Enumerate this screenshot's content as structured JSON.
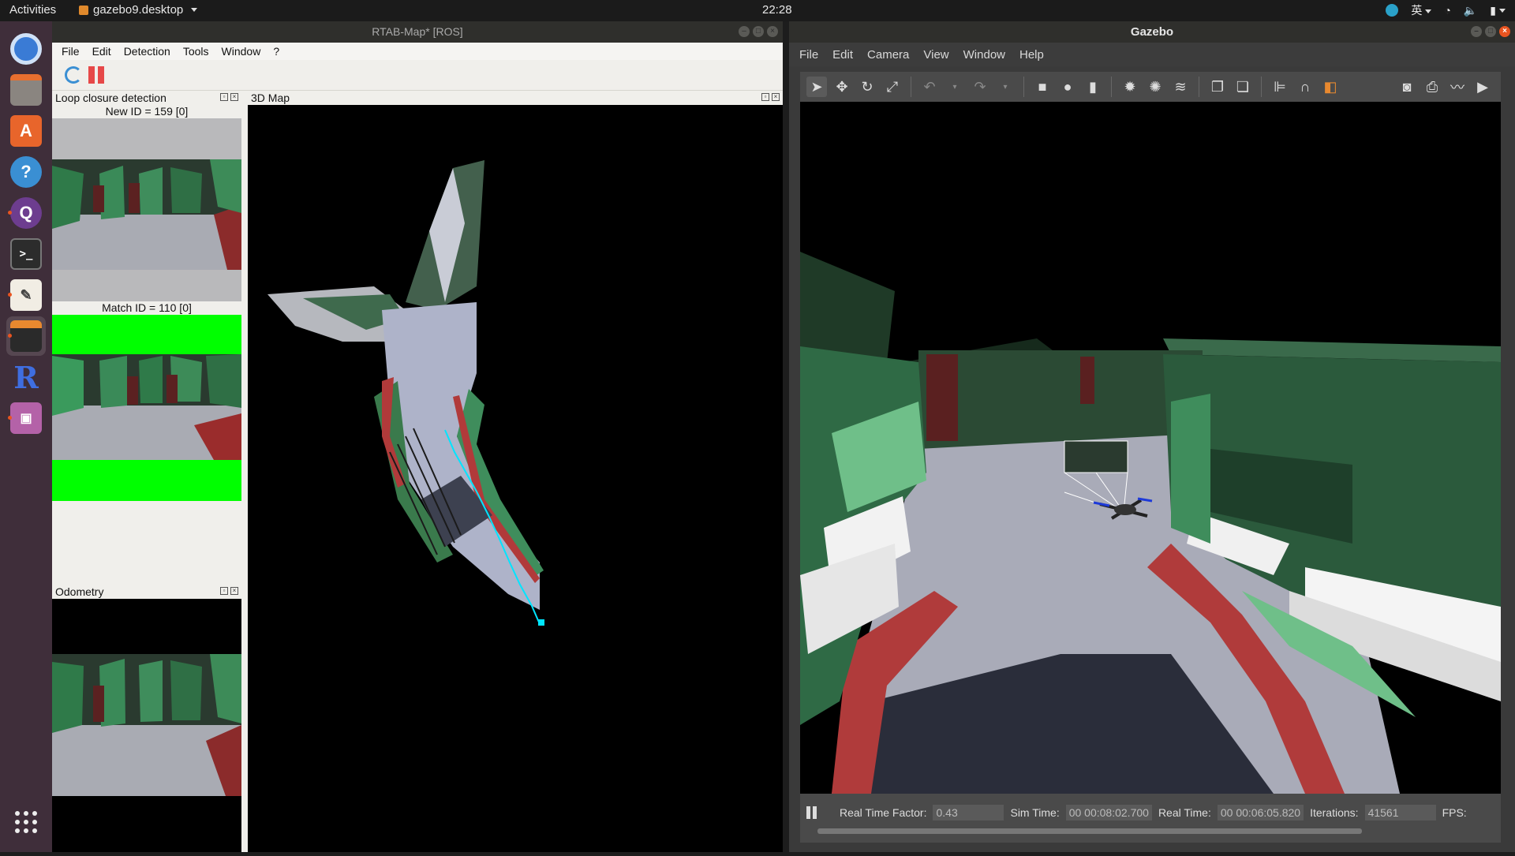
{
  "topbar": {
    "activities": "Activities",
    "app_name": "gazebo9.desktop",
    "clock": "22:28",
    "ime": "英"
  },
  "dock": {
    "items": [
      "chromium",
      "files",
      "software-center",
      "help",
      "qt-creator",
      "terminal",
      "text-editor",
      "rviz",
      "rtabmap",
      "network"
    ]
  },
  "rtab": {
    "title": "RTAB-Map* [ROS]",
    "menu": [
      "File",
      "Edit",
      "Detection",
      "Tools",
      "Window",
      "?"
    ],
    "loop_panel": {
      "title": "Loop closure detection",
      "new_id": "New ID = 159 [0]",
      "match_id": "Match ID = 110 [0]"
    },
    "odometry_panel": {
      "title": "Odometry"
    },
    "map_panel": {
      "title": "3D Map"
    }
  },
  "gazebo": {
    "title": "Gazebo",
    "menu": [
      "File",
      "Edit",
      "Camera",
      "View",
      "Window",
      "Help"
    ],
    "status": {
      "rtf_label": "Real Time Factor:",
      "rtf_value": "0.43",
      "sim_label": "Sim Time:",
      "sim_value": "00 00:08:02.700",
      "real_label": "Real Time:",
      "real_value": "00 00:06:05.820",
      "iter_label": "Iterations:",
      "iter_value": "41561",
      "fps_label": "FPS:"
    }
  },
  "colors": {
    "ubuntu_orange": "#e95420",
    "dock_bg": "#3f2e3a",
    "trajectory": "#00e5ff",
    "match_green": "#00ff00"
  }
}
